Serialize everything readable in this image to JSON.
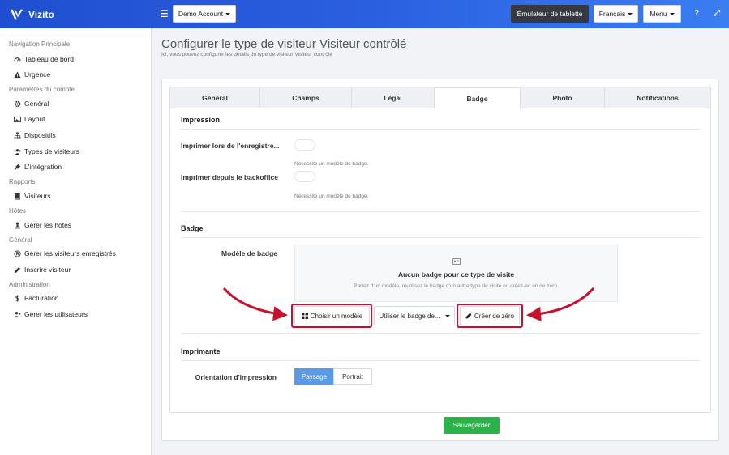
{
  "app": {
    "name": "Vizito"
  },
  "topbar": {
    "account_label": "Demo Account",
    "tablet_label": "Émulateur de tablette",
    "language_label": "Français",
    "menu_label": "Menu",
    "help_glyph": "?",
    "expand_glyph": "⤢"
  },
  "sidebar": {
    "sections": [
      {
        "title": "Navigation Principale",
        "items": [
          {
            "label": "Tableau de bord",
            "icon": "dashboard-icon"
          },
          {
            "label": "Urgence",
            "icon": "warning-icon"
          }
        ]
      },
      {
        "title": "Paramètres du compte",
        "items": [
          {
            "label": "Général",
            "icon": "gear-icon"
          },
          {
            "label": "Layout",
            "icon": "image-icon"
          },
          {
            "label": "Dispositifs",
            "icon": "sitemap-icon"
          },
          {
            "label": "Types de visiteurs",
            "icon": "users-icon"
          },
          {
            "label": "L'intégration",
            "icon": "plug-icon"
          }
        ]
      },
      {
        "title": "Rapports",
        "items": [
          {
            "label": "Visiteurs",
            "icon": "book-icon"
          }
        ]
      },
      {
        "title": "Hôtes",
        "items": [
          {
            "label": "Gérer les hôtes",
            "icon": "host-icon"
          }
        ]
      },
      {
        "title": "Général",
        "items": [
          {
            "label": "Gérer les visiteurs enregistrés",
            "icon": "registered-icon"
          },
          {
            "label": "Inscrire visiteur",
            "icon": "pencil-icon"
          }
        ]
      },
      {
        "title": "Administration",
        "items": [
          {
            "label": "Facturation",
            "icon": "dollar-icon"
          },
          {
            "label": "Gérer les utilisateurs",
            "icon": "user-plus-icon"
          }
        ]
      }
    ]
  },
  "page": {
    "title": "Configurer le type de visiteur Visiteur contrôlé",
    "subtitle": "Ici, vous pouvez configurer les détails du type de visiteur Visiteur contrôlé"
  },
  "tabs": [
    {
      "label": "Général",
      "active": false
    },
    {
      "label": "Champs",
      "active": false
    },
    {
      "label": "Légal",
      "active": false
    },
    {
      "label": "Badge",
      "active": true
    },
    {
      "label": "Photo",
      "active": false
    },
    {
      "label": "Notifications",
      "active": false
    }
  ],
  "impression": {
    "heading": "Impression",
    "print_on_register_label": "Imprimer lors de l'enregistre...",
    "print_on_register_help": "Nécessite un modèle de badge.",
    "print_from_backoffice_label": "Imprimer depuis le backoffice",
    "print_from_backoffice_help": "Nécessite un modèle de badge."
  },
  "badge": {
    "heading": "Badge",
    "model_label": "Modèle de badge",
    "empty_title": "Aucun badge pour ce type de visite",
    "empty_sub": "Partez d'un modèle, réutilisez le badge d'un autre type de visite ou créez-en un de zéro.",
    "choose_template": "Choisir un modèle",
    "use_badge_of": "Utiliser le badge de...",
    "create_from_scratch": "Créer de zéro"
  },
  "printer": {
    "heading": "Imprimante",
    "orientation_label": "Orientation d'impression",
    "options": [
      "Paysage",
      "Portrait"
    ],
    "selected": "Paysage"
  },
  "actions": {
    "save_label": "Sauvegarder"
  },
  "colors": {
    "accent": "#2a5fe0",
    "highlight": "#c8102e",
    "save": "#2bb34a",
    "selected": "#5b9be6"
  }
}
